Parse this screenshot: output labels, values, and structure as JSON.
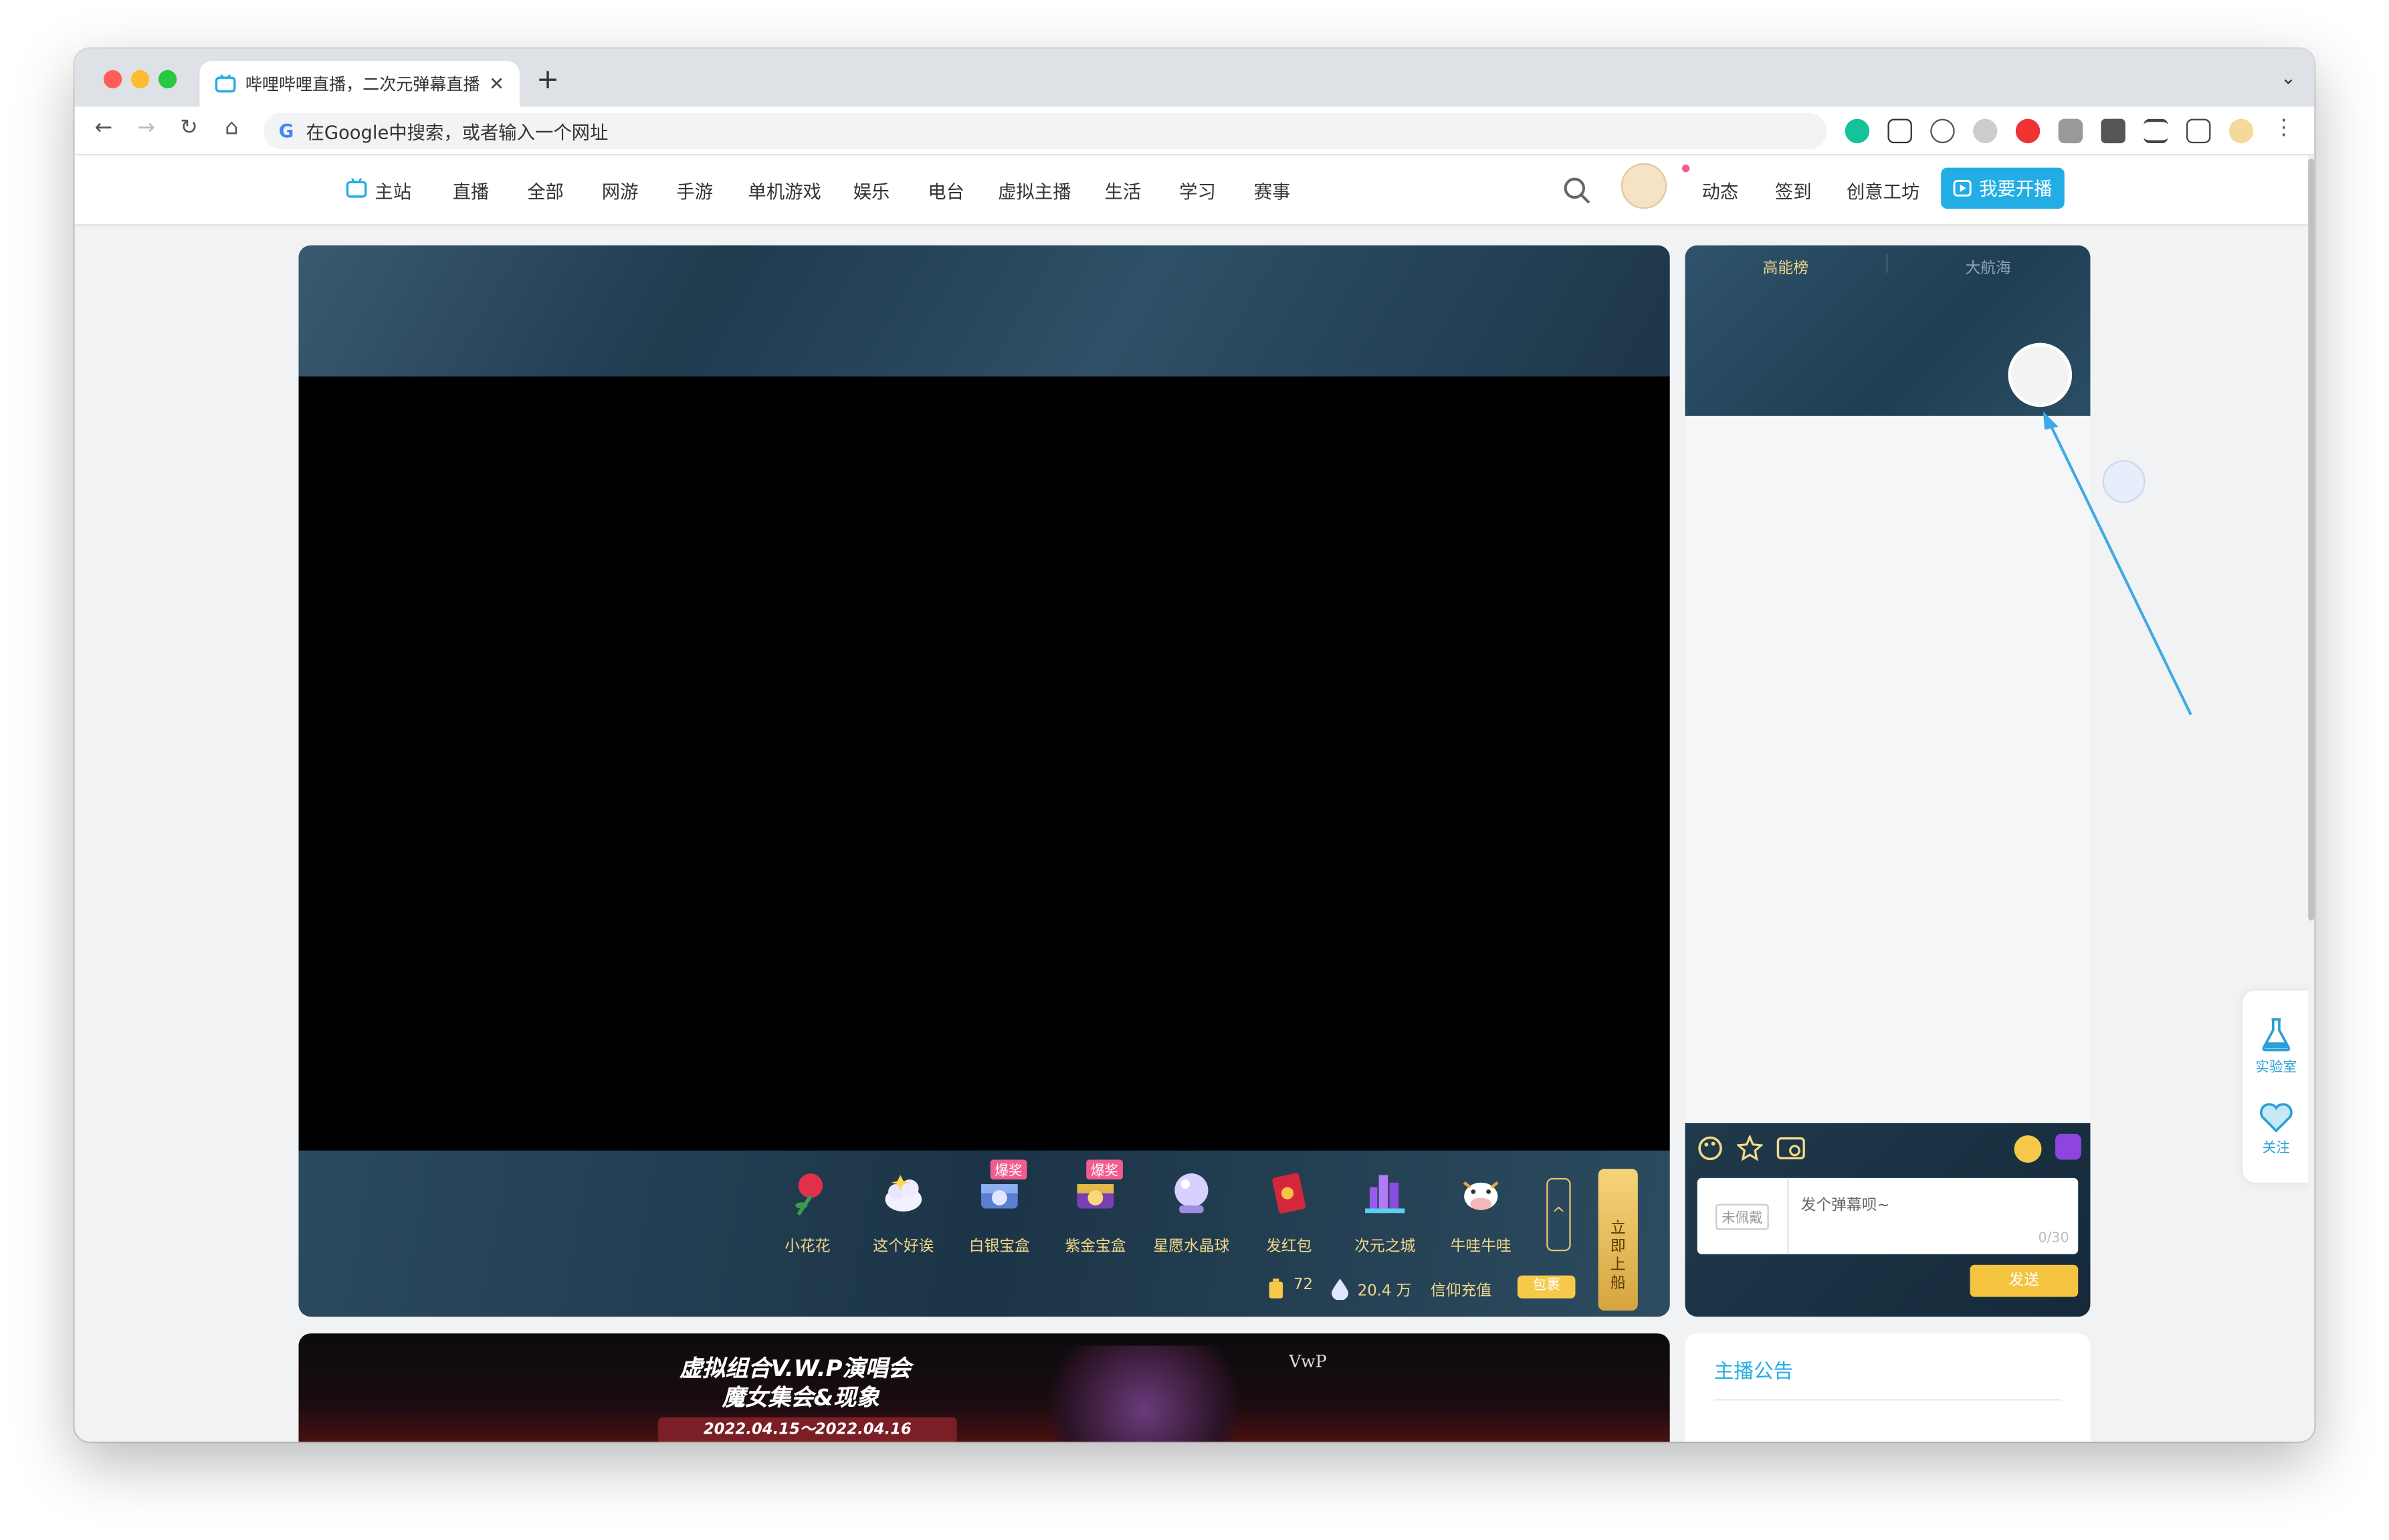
{
  "browser": {
    "tab_title": "哔哩哔哩直播，二次元弹幕直播平",
    "address_placeholder": "在Google中搜索，或者输入一个网址",
    "new_tab_label": "+",
    "close_tab_label": "✕",
    "tab_menu_label": "⌄",
    "back_label": "←",
    "forward_label": "→",
    "reload_label": "↻",
    "home_label": "⌂",
    "more_label": "⋮",
    "google_label": "G"
  },
  "site_nav": {
    "items": [
      "主站",
      "直播",
      "全部",
      "网游",
      "手游",
      "单机游戏",
      "娱乐",
      "电台",
      "虚拟主播",
      "生活",
      "学习",
      "赛事"
    ],
    "right_items": [
      "动态",
      "签到",
      "创意工坊"
    ],
    "open_live_label": "我要开播"
  },
  "gifts": [
    {
      "label": "小花花",
      "icon": "rose-icon",
      "badge": ""
    },
    {
      "label": "这个好诶",
      "icon": "cloud-icon",
      "badge": ""
    },
    {
      "label": "白银宝盒",
      "icon": "silver-box-icon",
      "badge": "爆奖"
    },
    {
      "label": "紫金宝盒",
      "icon": "gold-box-icon",
      "badge": "爆奖"
    },
    {
      "label": "星愿水晶球",
      "icon": "crystal-ball-icon",
      "badge": ""
    },
    {
      "label": "发红包",
      "icon": "red-envelope-icon",
      "badge": ""
    },
    {
      "label": "次元之城",
      "icon": "city-icon",
      "badge": ""
    },
    {
      "label": "牛哇牛哇",
      "icon": "cow-icon",
      "badge": ""
    }
  ],
  "player": {
    "expand_label": "^",
    "board_ship_label": "立即上船",
    "battery_count": "72",
    "coin_count": "20.4 万",
    "recharge_label": "信仰充值",
    "bag_label": "包裹"
  },
  "rank_tabs": [
    "高能榜",
    "大航海"
  ],
  "chat": {
    "badge_label": "未佩戴",
    "placeholder": "发个弹幕呗~",
    "counter": "0/30",
    "send_label": "发送"
  },
  "announcement": {
    "title": "主播公告"
  },
  "banner": {
    "line1": "虚拟组合V.W.P演唱会",
    "line2": "魔女集会&现象",
    "dates": "2022.04.15～2022.04.16",
    "logo": "VwP"
  },
  "side_float": {
    "lab_label": "实验室",
    "follow_label": "关注"
  },
  "colors": {
    "accent": "#23ade5",
    "gold": "#f2d98a",
    "badge_pink": "#f25d8e"
  }
}
